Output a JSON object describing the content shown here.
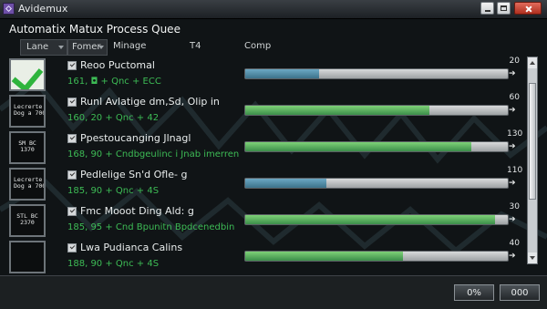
{
  "window": {
    "title": "Avidemux"
  },
  "heading": "Automatix Matux Process Quee",
  "columns": {
    "lane": "Lane",
    "fomer": "Fomer",
    "manage": "Minage",
    "t4": "T4",
    "comp": "Comp"
  },
  "jobs": [
    {
      "thumb": "check",
      "title": "Reoo Puctomal",
      "meta": "161, ◘ + Qnc + ECC",
      "pct": "20",
      "progress": 0.28,
      "color": "blue"
    },
    {
      "thumb": "Lecrerte\nDog a 700",
      "title": "Runl Avlatige dm,Sd, Olip in",
      "meta": "160, 20 + Qnc + 42",
      "pct": "60",
      "progress": 0.7,
      "color": "green"
    },
    {
      "thumb": "SM BC\n1370",
      "title": "Ppestoucanging Jlnagl",
      "meta": "168, 90 + Cndbgeulinc i Jnab imerren",
      "pct": "130",
      "progress": 0.86,
      "color": "green"
    },
    {
      "thumb": "Lecrerte\nDog a 700",
      "title": "Pedlelige Sn'd Ofle- g",
      "meta": "185, 90 + Qnc + 4S",
      "pct": "110",
      "progress": 0.31,
      "color": "blue"
    },
    {
      "thumb": "STL BC\n2370",
      "title": "Fmc Mooot Ding Ald: g",
      "meta": "185, 95 + Cnd Bpunitn Bpdcenedbin",
      "pct": "30",
      "progress": 0.95,
      "color": "green"
    },
    {
      "thumb": "",
      "title": "Lwa Pudianca Calins",
      "meta": "188, 90 + Qnc + 4S",
      "pct": "40",
      "progress": 0.6,
      "color": "green"
    }
  ],
  "buttons": {
    "pct": "0%",
    "zero": "000"
  },
  "colors": {
    "accent_green": "#3dbb55",
    "progress_blue": "#2a6a86"
  }
}
